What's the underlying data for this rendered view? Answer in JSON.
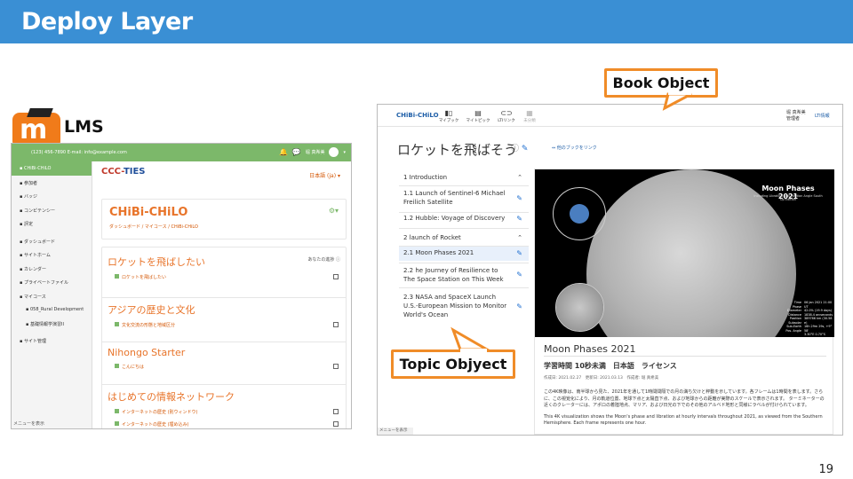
{
  "slide": {
    "title": "Deploy Layer",
    "page_number": "19",
    "lms_label": "LMS",
    "callouts": {
      "book": "Book Object",
      "topic": "Topic Objyect"
    }
  },
  "lms": {
    "contact": "(123) 456-7890 E-mail: info@example.com",
    "lang": "日本語 (ja) ▾",
    "logo_text_a": "CCC-",
    "logo_text_b": "TIES",
    "sidebar": [
      {
        "label": "CHiBi-CHiLO",
        "active": true
      },
      {
        "label": "参加者"
      },
      {
        "label": "バッジ"
      },
      {
        "label": "コンピテンシー"
      },
      {
        "label": "評定"
      },
      {
        "label": "ダッシュボード",
        "sep": true
      },
      {
        "label": "サイトホーム"
      },
      {
        "label": "カレンダー"
      },
      {
        "label": "プライベートファイル"
      },
      {
        "label": "マイコース"
      },
      {
        "label": "058_Rural Development",
        "sub": true
      },
      {
        "label": "基礎情報学演習II",
        "sub": true
      },
      {
        "label": "サイト管理",
        "sep": true
      }
    ],
    "sidebar_footer": "メニューを表示",
    "course": {
      "title": "CHiBi-CHiLO",
      "breadcrumb": "ダッシュボード / マイコース / CHiBi-CHiLO"
    },
    "progress_label": "あなたの進捗",
    "sections": [
      {
        "title": "ロケットを飛ばしたい",
        "activities": [
          "ロケットを飛ばしたい"
        ]
      },
      {
        "title": "アジアの歴史と文化",
        "activities": [
          "文化交流の形態と地域区分"
        ]
      },
      {
        "title": "Nihongo Starter",
        "activities": [
          "こんにちは"
        ]
      },
      {
        "title": "はじめての情報ネットワーク",
        "activities": [
          "インターネットの歴史 (別ウィンドウ)",
          "インターネットの歴史 (埋め込み)"
        ]
      }
    ]
  },
  "chibi": {
    "brand": "CHiBi-CHiLO",
    "nav": [
      {
        "label": "マイブック",
        "icon": "book-icon"
      },
      {
        "label": "マイトピック",
        "icon": "topic-icon"
      },
      {
        "label": "LTIリンク",
        "icon": "link-icon"
      },
      {
        "label": "未分類",
        "icon": "grid-icon",
        "dim": true
      }
    ],
    "user": "堀 真希美",
    "user_role": "管理者",
    "lti": "LTI情報",
    "book_title": "ロケットを飛ばそう",
    "link_other": "他のブックをリンク",
    "toc": [
      {
        "label": "1 Introduction",
        "kind": "chapter"
      },
      {
        "label": "1.1 Launch of Sentinel-6 Michael Freilich Satellite",
        "kind": "topic"
      },
      {
        "label": "1.2 Hubble: Voyage of Discovery",
        "kind": "topic"
      },
      {
        "label": "2 launch of Rocket",
        "kind": "chapter"
      },
      {
        "label": "2.1 Moon Phases 2021",
        "kind": "topic",
        "selected": true
      },
      {
        "label": "2.2 he Journey of Resilience to The Space Station on This Week",
        "kind": "topic"
      },
      {
        "label": "2.3 NASA and SpaceX Launch U.S.-European Mission to Monitor World's Ocean",
        "kind": "topic"
      }
    ],
    "poster": {
      "title": "Moon Phases 2021",
      "subtitle": "Including Libration and Position Angle South Up Edition",
      "stat_labels": [
        "Time",
        "Phase",
        "Diameter",
        "Distance",
        "Position",
        "Subsolar",
        "Sub-Earth",
        "Pos. Angle"
      ],
      "stat_values": [
        "06 Jan 2021 21:00 UT",
        "42.0% (19.9 days)",
        "1838.4 arcseconds",
        "389766 km (30.58 e)",
        "16h 29m 29s, +9° 58'",
        "3.30°E 0.70°S",
        "4.06°E 6.56°S",
        "29.2°"
      ]
    },
    "content": {
      "title": "Moon Phases 2021",
      "meta": "学習時間 10秒未満　日本語　ライセンス",
      "dates": "作成日: 2021.02.27　更新日: 2021.03.13　作成者: 堀 真希美",
      "body_ja": "この4K映像は、南半球から見た、2021年を通して1時間間隔での月の満ち欠けと秤動を示しています。各フレームは1時間を表します。さらに、この視覚化により、月の軌道位置、地球下点と太陽直下点、および地球からの距離が実際のスケールで表示されます。 ターミネーターの近くのクレーターには、アポロの着陸地点、マリア、および日光の下でのその他のアルベド地形と同様にラベルが付けられています。",
      "body_en": "This 4K visualization shows the Moon's phase and libration at hourly intervals throughout 2021, as viewed from the Southern Hemisphere. Each frame represents one hour."
    },
    "menu_tab": "メニューを表示"
  }
}
